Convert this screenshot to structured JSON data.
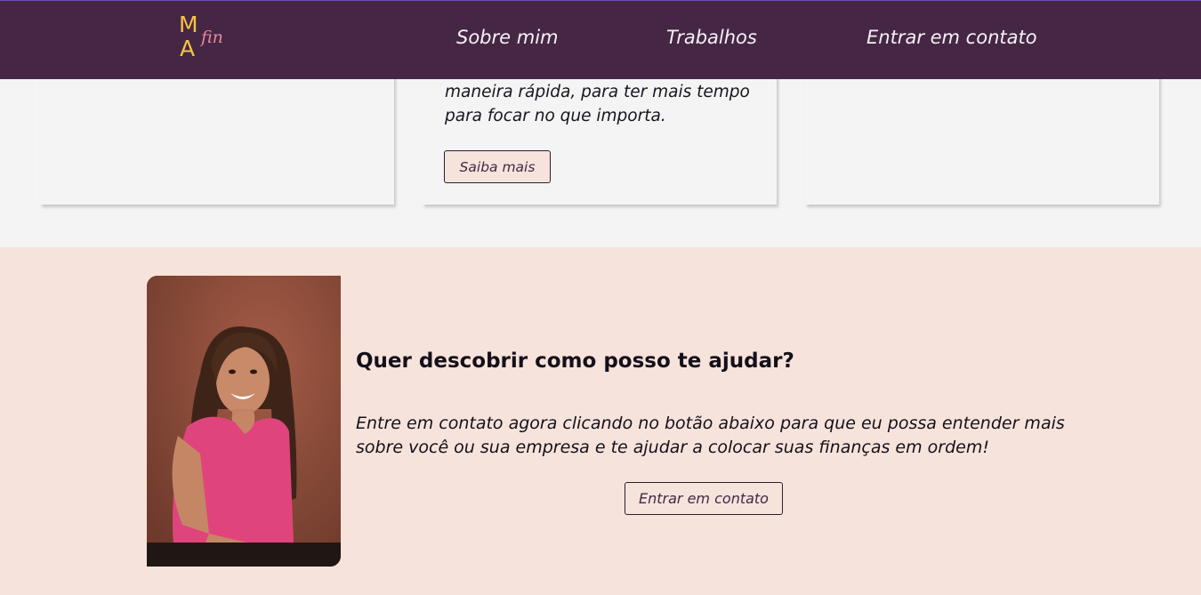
{
  "header": {
    "logo": {
      "letter_top": "M",
      "letter_bottom": "A",
      "script": "fin"
    },
    "nav": [
      "Sobre mim",
      "Trabalhos",
      "Entrar em contato"
    ]
  },
  "cards": {
    "middle": {
      "text_line1": "maneira rápida, para ter mais tempo",
      "text_line2": "para focar no que importa.",
      "button": "Saiba mais"
    }
  },
  "contact": {
    "title": "Quer descobrir como posso te ajudar?",
    "text_line1": "Entre em contato agora clicando no botão abaixo para que eu possa entender mais",
    "text_line2": "sobre você ou sua empresa e te ajudar a colocar suas finanças em ordem!",
    "button": "Entrar em contato"
  },
  "colors": {
    "header_bg": "#452745",
    "logo_yellow": "#f5c343",
    "logo_pink": "#e8889a",
    "section_bg": "#f4f4f4",
    "contact_bg": "#f6e3db"
  }
}
